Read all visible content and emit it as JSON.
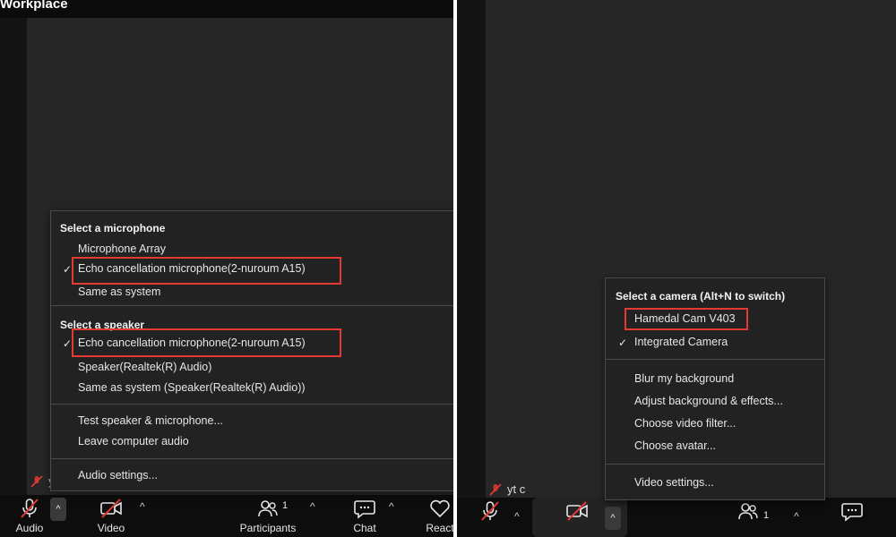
{
  "colors": {
    "highlight": "#e53935",
    "menu_bg": "#222222",
    "stage_bg": "#262626",
    "toolbar_bg": "#0d0d0d"
  },
  "left": {
    "title": "Workplace",
    "participant_tag": "y",
    "audio_menu": {
      "microphone_heading": "Select a microphone",
      "microphones": [
        {
          "label": "Microphone Array",
          "checked": false
        },
        {
          "label": "Echo cancellation microphone(2-nuroum A15)",
          "checked": true,
          "highlighted": true
        },
        {
          "label": "Same as system",
          "checked": false
        }
      ],
      "speaker_heading": "Select a speaker",
      "speakers": [
        {
          "label": "Echo cancellation microphone(2-nuroum A15)",
          "checked": true,
          "highlighted": true
        },
        {
          "label": "Speaker(Realtek(R) Audio)",
          "checked": false
        },
        {
          "label": "Same as system (Speaker(Realtek(R) Audio))",
          "checked": false
        }
      ],
      "actions": [
        "Test speaker & microphone...",
        "Leave computer audio"
      ],
      "settings": "Audio settings...",
      "check_glyph": "✓"
    },
    "toolbar": {
      "audio_label": "Audio",
      "video_label": "Video",
      "participants_label": "Participants",
      "participants_count": "1",
      "chat_label": "Chat",
      "react_label": "React",
      "caret_glyph": "^"
    }
  },
  "right": {
    "participant_tag": "yt c",
    "video_menu": {
      "camera_heading": "Select a camera (Alt+N to switch)",
      "cameras": [
        {
          "label": "Hamedal Cam V403",
          "checked": false,
          "highlighted": true
        },
        {
          "label": "Integrated Camera",
          "checked": true
        }
      ],
      "effects": [
        "Blur my background",
        "Adjust background & effects...",
        "Choose video filter...",
        "Choose avatar..."
      ],
      "settings": "Video settings...",
      "check_glyph": "✓"
    },
    "toolbar": {
      "participants_count": "1",
      "caret_glyph": "^"
    }
  },
  "icons": [
    "microphone-muted-icon",
    "camera-off-icon",
    "participants-icon",
    "chat-icon",
    "heart-icon",
    "chevron-up-icon",
    "check-icon"
  ]
}
